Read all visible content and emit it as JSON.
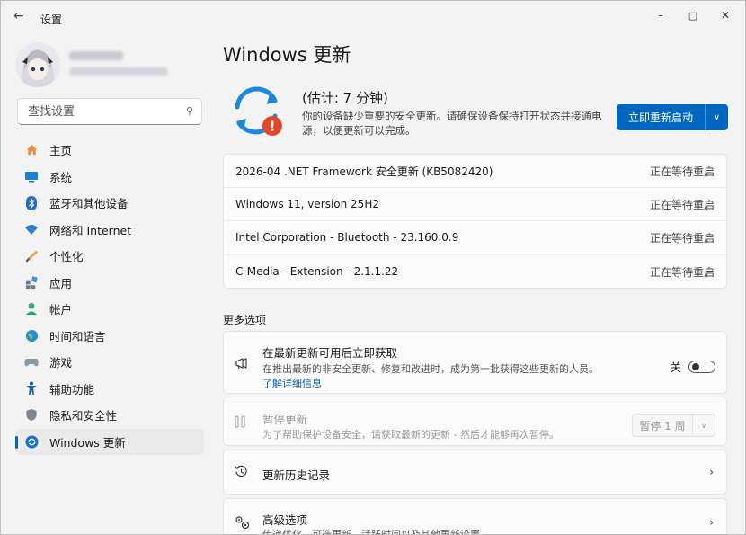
{
  "window": {
    "back_glyph": "←",
    "title": "设置",
    "minimize_glyph": "–",
    "maximize_glyph": "▢",
    "close_glyph": "✕"
  },
  "sidebar": {
    "search_placeholder": "查找设置",
    "items": [
      {
        "label": "主页",
        "icon": "home-icon"
      },
      {
        "label": "系统",
        "icon": "system-icon"
      },
      {
        "label": "蓝牙和其他设备",
        "icon": "bluetooth-icon"
      },
      {
        "label": "网络和 Internet",
        "icon": "wifi-icon"
      },
      {
        "label": "个性化",
        "icon": "brush-icon"
      },
      {
        "label": "应用",
        "icon": "apps-icon"
      },
      {
        "label": "帐户",
        "icon": "account-icon"
      },
      {
        "label": "时间和语言",
        "icon": "globe-icon"
      },
      {
        "label": "游戏",
        "icon": "gamepad-icon"
      },
      {
        "label": "辅助功能",
        "icon": "accessibility-icon"
      },
      {
        "label": "隐私和安全性",
        "icon": "shield-icon"
      },
      {
        "label": "Windows 更新",
        "icon": "windows-update-icon",
        "active": true
      }
    ]
  },
  "main": {
    "title": "Windows 更新",
    "status": {
      "title": "(估计: 7 分钟)",
      "description": "你的设备缺少重要的安全更新。请确保设备保持打开状态并接通电源，以便更新可以完成。",
      "restart_button": "立即重新启动",
      "alert_glyph": "!"
    },
    "updates": [
      {
        "name": "2026-04 .NET Framework 安全更新 (KB5082420)",
        "status": "正在等待重启"
      },
      {
        "name": "Windows 11, version 25H2",
        "status": "正在等待重启"
      },
      {
        "name": "Intel Corporation - Bluetooth - 23.160.0.9",
        "status": "正在等待重启"
      },
      {
        "name": "C-Media - Extension - 2.1.1.22",
        "status": "正在等待重启"
      }
    ],
    "more_options_heading": "更多选项",
    "get_latest": {
      "title": "在最新更新可用后立即获取",
      "description": "在推出最新的非安全更新、修复和改进时，成为第一批获得这些更新的人员。",
      "link": "了解详细信息",
      "toggle_label": "关",
      "toggle_on": false
    },
    "pause": {
      "title": "暂停更新",
      "description": "为了帮助保护设备安全，请获取最新的更新 - 然后才能够再次暂停。",
      "select_value": "暂停 1 周"
    },
    "history": {
      "title": "更新历史记录"
    },
    "advanced": {
      "title": "高级选项",
      "description": "传递优化、可选更新、活跃时间以及其他更新设置"
    }
  },
  "colors": {
    "accent": "#0067c0",
    "alert": "#e0492b",
    "sync_blue": "#1e88d8"
  }
}
